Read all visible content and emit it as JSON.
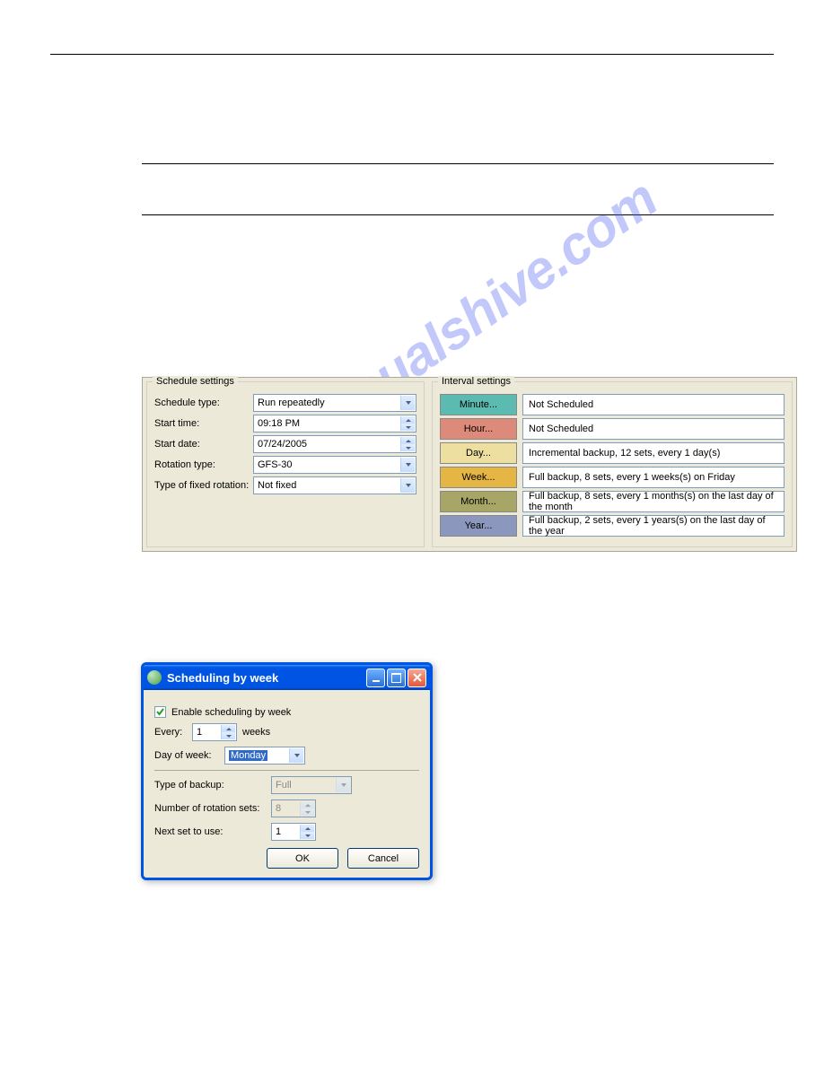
{
  "watermark_text": "manualshive.com",
  "schedule": {
    "legend": "Schedule settings",
    "rows": {
      "schedule_type": {
        "label": "Schedule type:",
        "value": "Run repeatedly"
      },
      "start_time": {
        "label": "Start time:",
        "value": "09:18 PM"
      },
      "start_date": {
        "label": "Start date:",
        "value": "07/24/2005"
      },
      "rotation_type": {
        "label": "Rotation type:",
        "value": "GFS-30"
      },
      "fixed_rotation": {
        "label": "Type of fixed rotation:",
        "value": "Not fixed"
      }
    }
  },
  "interval": {
    "legend": "Interval settings",
    "items": [
      {
        "label": "Minute...",
        "text": "Not Scheduled",
        "class": "ibtn-minute"
      },
      {
        "label": "Hour...",
        "text": "Not Scheduled",
        "class": "ibtn-hour"
      },
      {
        "label": "Day...",
        "text": "Incremental backup, 12 sets, every 1 day(s)",
        "class": "ibtn-day"
      },
      {
        "label": "Week...",
        "text": "Full backup, 8 sets, every 1 weeks(s) on Friday",
        "class": "ibtn-week"
      },
      {
        "label": "Month...",
        "text": "Full backup, 8 sets, every 1 months(s) on the last day of the month",
        "class": "ibtn-month"
      },
      {
        "label": "Year...",
        "text": "Full backup, 2 sets, every 1 years(s) on the last day of the year",
        "class": "ibtn-year"
      }
    ]
  },
  "dialog": {
    "title": "Scheduling by week",
    "enable_label": "Enable scheduling by week",
    "every_label": "Every:",
    "every_value": "1",
    "weeks_label": "weeks",
    "dow_label": "Day of week:",
    "dow_value": "Monday",
    "type_label": "Type of backup:",
    "type_value": "Full",
    "sets_label": "Number of rotation sets:",
    "sets_value": "8",
    "next_label": "Next set to use:",
    "next_value": "1",
    "ok": "OK",
    "cancel": "Cancel"
  }
}
